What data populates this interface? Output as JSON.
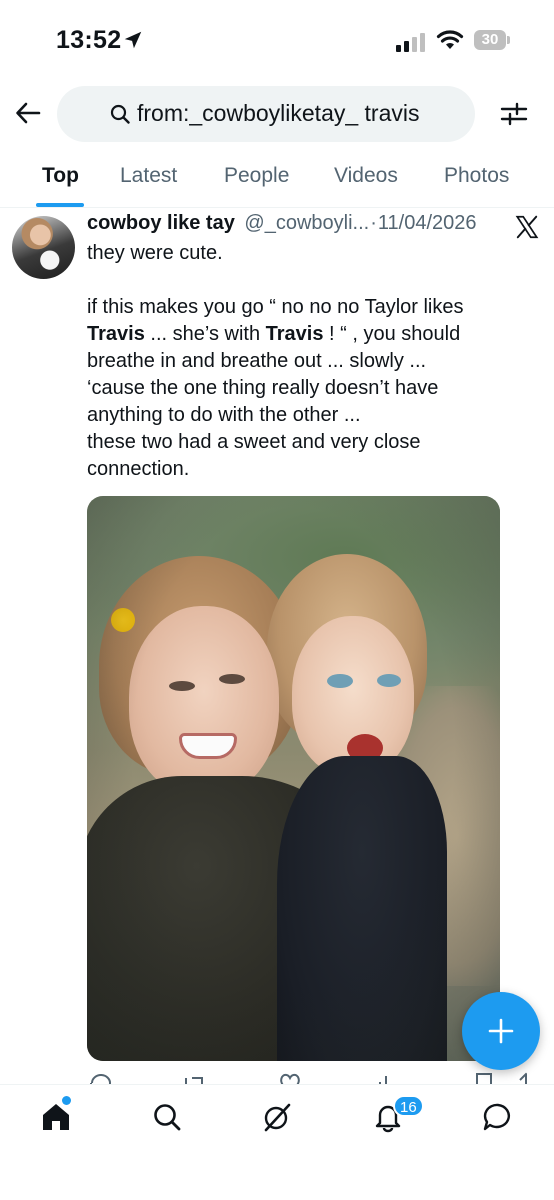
{
  "status_bar": {
    "time": "13:52",
    "battery": "30",
    "icons": [
      "location-arrow-icon",
      "cellular-signal-icon",
      "wifi-icon",
      "battery-icon"
    ]
  },
  "search": {
    "query": "from:_cowboyliketay_ travis"
  },
  "tabs": [
    {
      "label": "Top",
      "active": true
    },
    {
      "label": "Latest",
      "active": false
    },
    {
      "label": "People",
      "active": false
    },
    {
      "label": "Videos",
      "active": false
    },
    {
      "label": "Photos",
      "active": false
    }
  ],
  "tweet": {
    "display_name": "cowboy like tay",
    "handle": "@_cowboyli...",
    "separator": "·",
    "date": "11/04/2026",
    "line1": "they were cute.",
    "line2_pre": "if this makes you go “ no no no Taylor likes",
    "line3_b1": "Travis",
    "line3_mid": " ... she’s with ",
    "line3_b2": "Travis",
    "line3_post": " !  “ , you should",
    "line4": "breathe in and breathe out  ... slowly  ...",
    "line5": "‘cause the one thing really doesn’t have",
    "line6": "anything to do with the other ...",
    "line7": "these two had a sweet and very close",
    "line8": "connection.",
    "photo_alt": "Photo of two smiling women hugging outdoors",
    "actions": [
      "reply-icon",
      "retweet-icon",
      "like-icon",
      "views-icon",
      "bookmark-icon",
      "share-icon"
    ]
  },
  "fab": {
    "icon": "plus-icon"
  },
  "bottom_nav": {
    "items": [
      "home-icon",
      "search-icon",
      "grok-icon",
      "notifications-icon",
      "messages-icon"
    ],
    "notifications_badge": "16"
  },
  "colors": {
    "accent": "#1d9bf0",
    "text_primary": "#0f1419",
    "text_secondary": "#536471",
    "search_bg": "#eff3f4"
  }
}
